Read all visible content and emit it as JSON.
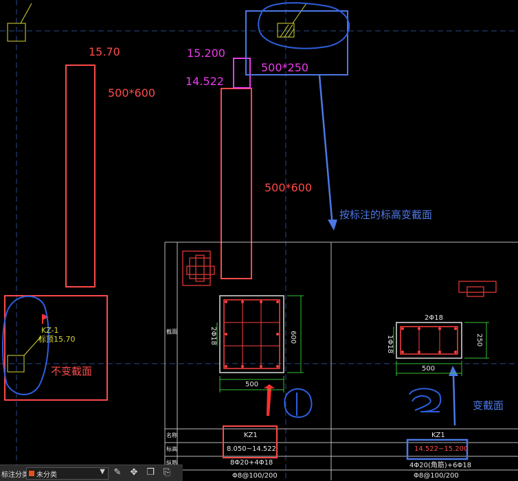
{
  "annotations": {
    "left_elev": "15.70",
    "left_size": "500*600",
    "mag_top": "15.200",
    "mag_bot": "14.522",
    "small_size": "500*250",
    "mid_size": "500*600",
    "note_variable": "按标注的标高变截面",
    "note_constant": "不变截面",
    "note_change": "变截面",
    "kz_label": "KZ-1",
    "kz_elev": "标顶15.70"
  },
  "table": {
    "row_name": "名称",
    "row_elev": "标高",
    "row_rebar": "纵筋",
    "row_section": "截面",
    "col1": {
      "name": "KZ1",
      "elev": "8.050~14.522",
      "rebar": "8Φ20+4Φ18",
      "stirrup": "Φ8@100/200",
      "dim_w": "500",
      "dim_h": "600",
      "side": "2Φ18"
    },
    "col2": {
      "name": "KZ1",
      "elev": "14.522~15.200",
      "rebar": "4Φ20(角筋)+6Φ18",
      "stirrup": "Φ8@100/200",
      "dim_w": "500",
      "dim_h": "250",
      "top": "2Φ18",
      "side": "1Φ18"
    }
  },
  "toolbar": {
    "label": "标注分类",
    "select_value": "未分类",
    "icons": [
      "edit-icon",
      "move-icon",
      "copy-icon",
      "paste-icon"
    ]
  },
  "colors": {
    "red": "#ff4a4a",
    "magenta": "#e83ce8",
    "blue": "#4d78e6",
    "yellow": "#d9d93a",
    "green": "#33c233"
  }
}
